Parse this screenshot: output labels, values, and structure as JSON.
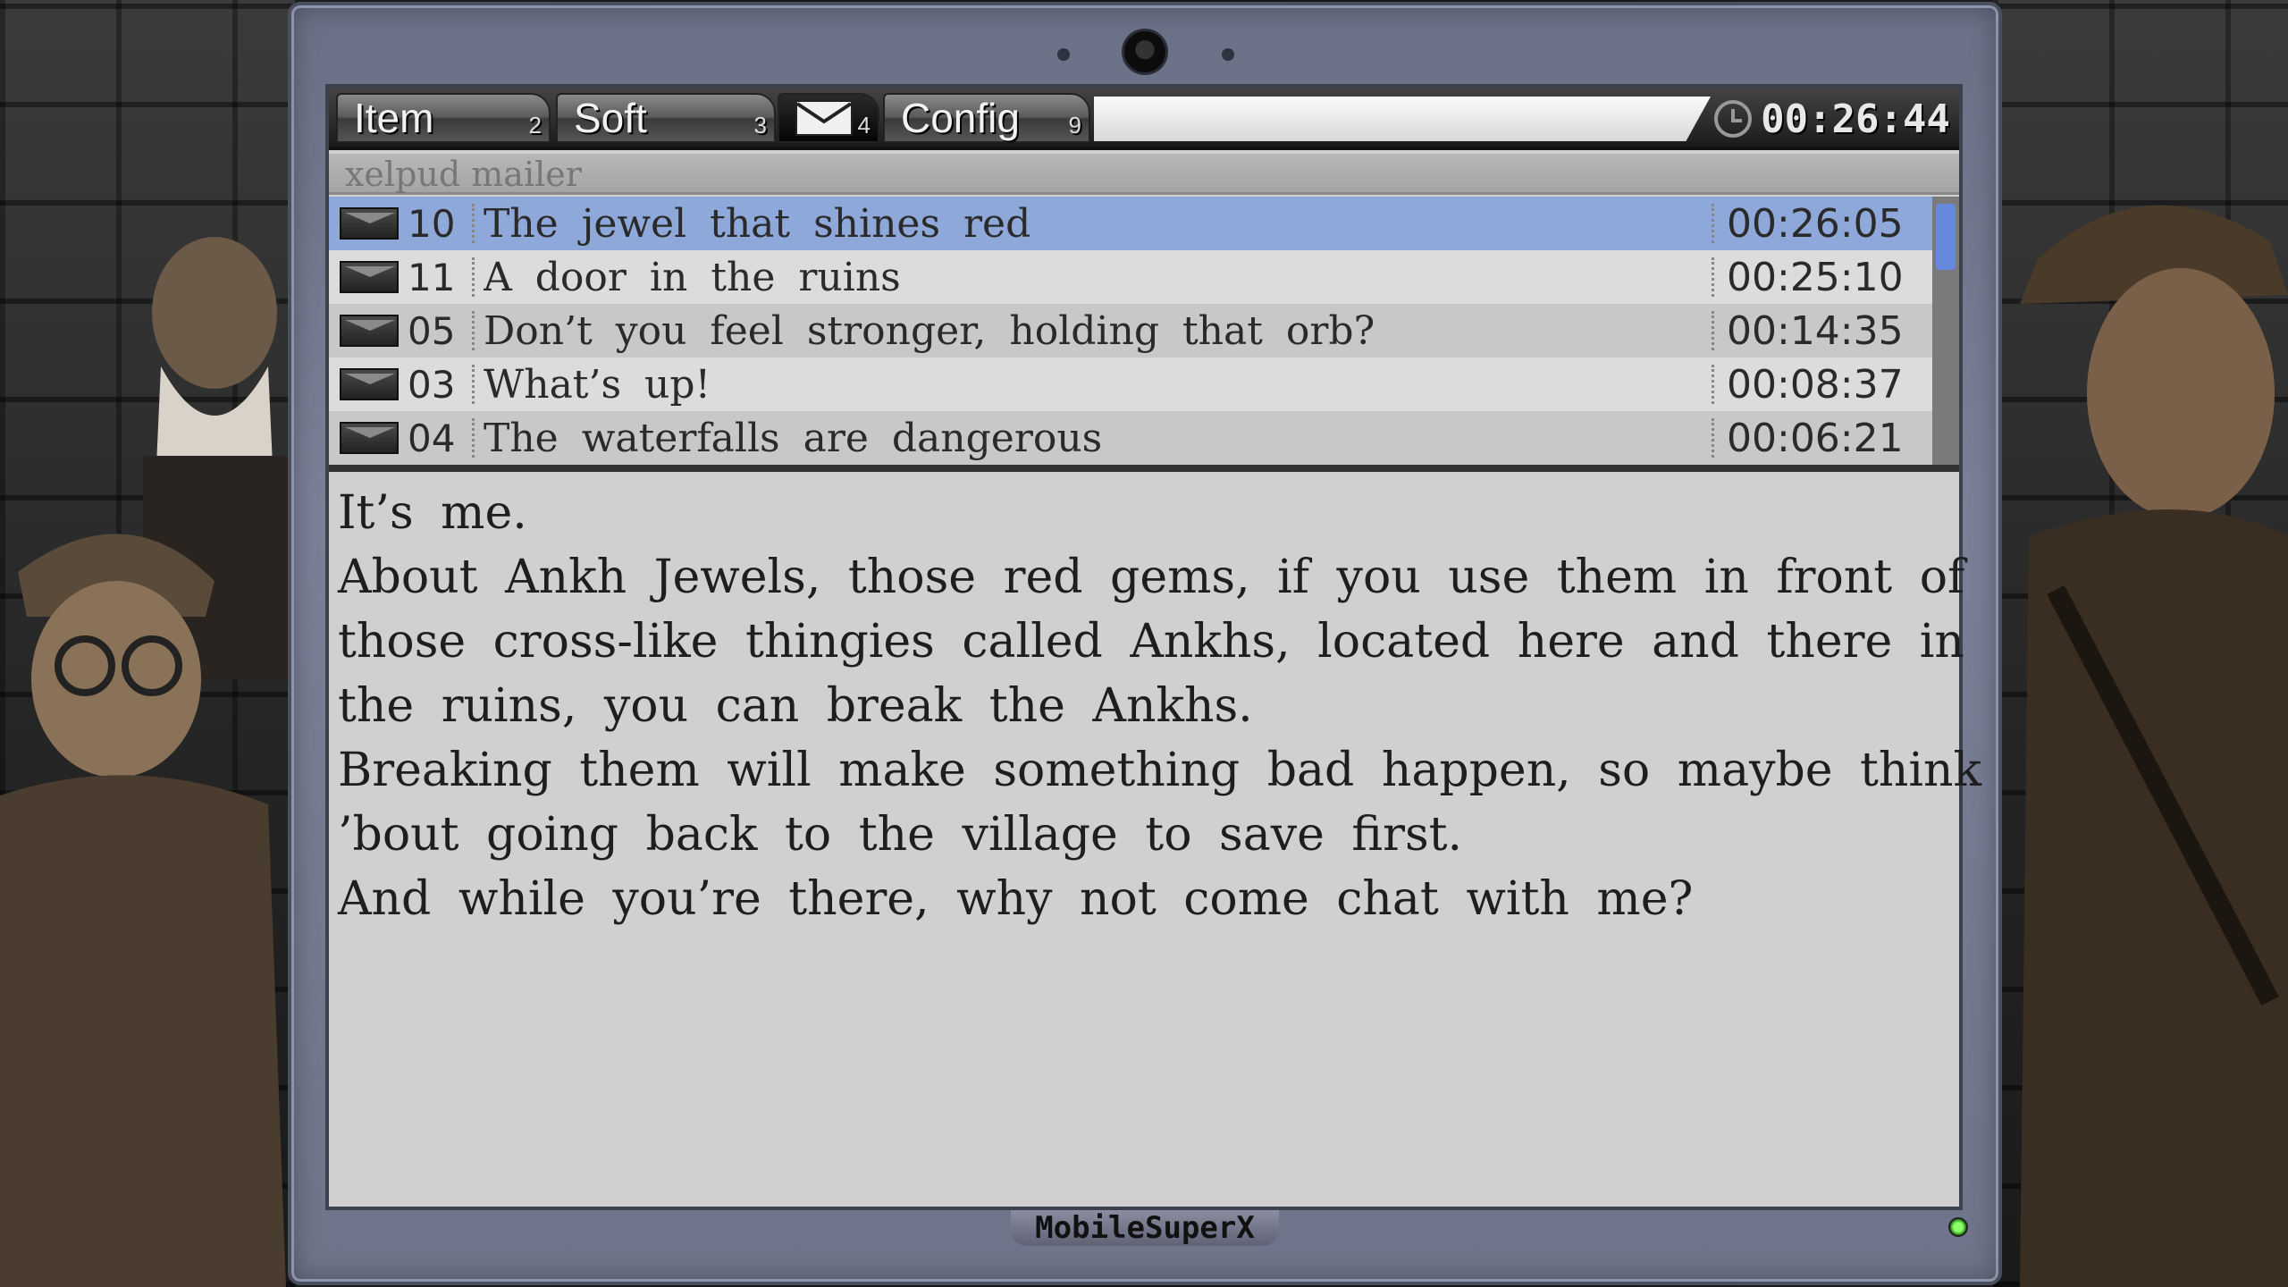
{
  "tabs": [
    {
      "label": "Item",
      "num": "2"
    },
    {
      "label": "Soft",
      "num": "3"
    },
    {
      "label": "",
      "num": "4"
    },
    {
      "label": "Config",
      "num": "9"
    }
  ],
  "clock": "00:26:44",
  "mailer": {
    "title": "xelpud mailer"
  },
  "mails": [
    {
      "no": "10",
      "subject": "The jewel that shines red",
      "time": "00:26:05"
    },
    {
      "no": "11",
      "subject": "A door in the ruins",
      "time": "00:25:10"
    },
    {
      "no": "05",
      "subject": "Don’t you feel stronger, holding that orb?",
      "time": "00:14:35"
    },
    {
      "no": "03",
      "subject": "What’s up!",
      "time": "00:08:37"
    },
    {
      "no": "04",
      "subject": "The waterfalls are dangerous",
      "time": "00:06:21"
    }
  ],
  "message": {
    "lines": [
      "It’s me.",
      "About Ankh Jewels, those red gems, if you use them in front of",
      "those cross-like thingies called Ankhs, located here and there in",
      "the ruins, you can break the Ankhs.",
      "Breaking them will make something bad happen, so maybe think",
      "’bout going back to the village to save first.",
      "And while you’re there, why not come chat with me?"
    ]
  },
  "device": {
    "brand": "MobileSuperX"
  },
  "colors": {
    "selected_row": "#8fa8da",
    "scroll_thumb": "#6688dd",
    "led": "#4cd42a"
  }
}
